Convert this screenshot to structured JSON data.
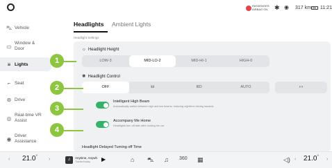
{
  "status": {
    "airbag_line1": "PASSENGER",
    "airbag_line2": "AIRBAG ON",
    "range": "317 km",
    "time": "11:21"
  },
  "sidebar": {
    "items": [
      {
        "label": "Vehicle",
        "icon": "car-icon"
      },
      {
        "label": "Window & Door",
        "icon": "window-icon"
      },
      {
        "label": "Lights",
        "icon": "lights-icon"
      },
      {
        "label": "Seat",
        "icon": "seat-icon"
      },
      {
        "label": "Drive",
        "icon": "steering-icon"
      },
      {
        "label": "Real-time VR Assist",
        "icon": "vr-icon"
      },
      {
        "label": "Driver Assistance",
        "icon": "assist-icon"
      }
    ]
  },
  "tabs": {
    "active": "Headlights",
    "inactive": "Ambient Lights"
  },
  "subhead": "Headlight Settings",
  "height": {
    "title": "Headlight Height",
    "options": [
      "LOW-3",
      "MID-LO-2",
      "MID-HI-1",
      "HIGH-0"
    ],
    "selected": "MID-LO-2"
  },
  "control": {
    "title": "Headlight Control",
    "options": [
      "OFF",
      "",
      "",
      "AUTO"
    ],
    "selected": "OFF"
  },
  "intelligent": {
    "title": "Intelligent High Beam",
    "desc": "Automatically switch between high and low beams, reducing nighttime driving hazards",
    "on": true
  },
  "accompany": {
    "title": "Accompany Me Home",
    "desc": "Headlights turn off later after locking the car",
    "on": true
  },
  "delayed_title": "Headlight Delayed Turning off Time",
  "callouts": [
    "1",
    "2",
    "3",
    "4"
  ],
  "bottom": {
    "temp_left": "21.0",
    "temp_right": "21.0",
    "music_title": "Anytime, Anywh",
    "music_sub": "Tracked today",
    "dock_360": "360"
  },
  "colors": {
    "accent_green": "#36b36a",
    "callout_green": "#8cc63f",
    "airbag_red": "#e0474c"
  }
}
